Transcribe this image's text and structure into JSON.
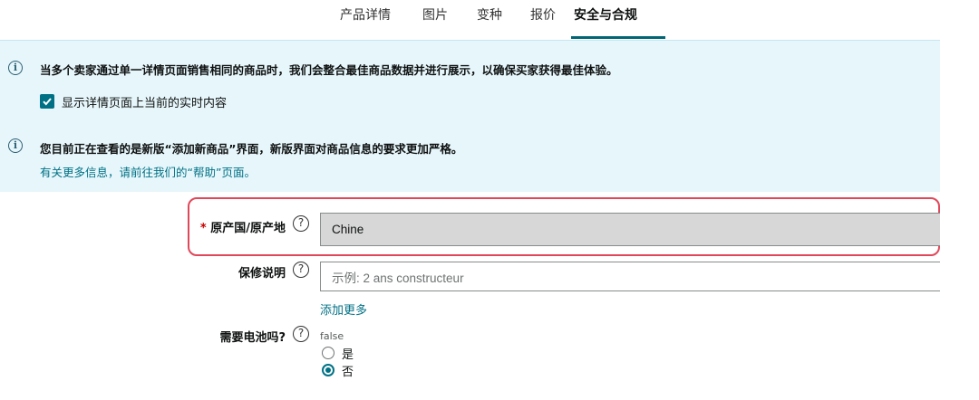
{
  "tabs": [
    {
      "label": "产品详情"
    },
    {
      "label": "图片"
    },
    {
      "label": "变种"
    },
    {
      "label": "报价"
    },
    {
      "label": "安全与合规"
    }
  ],
  "info": {
    "message1": "当多个卖家通过单一详情页面销售相同的商品时，我们会整合最佳商品数据并进行展示，以确保买家获得最佳体验。",
    "checkbox_label": "显示详情页面上当前的实时内容",
    "message2": "您目前正在查看的是新版“添加新商品”界面，新版界面对商品信息的要求更加严格。",
    "link": "有关更多信息，请前往我们的“帮助”页面。"
  },
  "form": {
    "origin": {
      "required_mark": "*",
      "label": "原产国/原产地",
      "value": "Chine"
    },
    "warranty": {
      "label": "保修说明",
      "placeholder": "示例:  2 ans constructeur",
      "add_more": "添加更多"
    },
    "battery": {
      "label": "需要电池吗?",
      "hint": "false",
      "option_yes": "是",
      "option_no": "否",
      "selected": "否"
    }
  },
  "colors": {
    "accent": "#007185",
    "highlight": "#e0485a",
    "panel_bg": "#e6f6fb"
  }
}
